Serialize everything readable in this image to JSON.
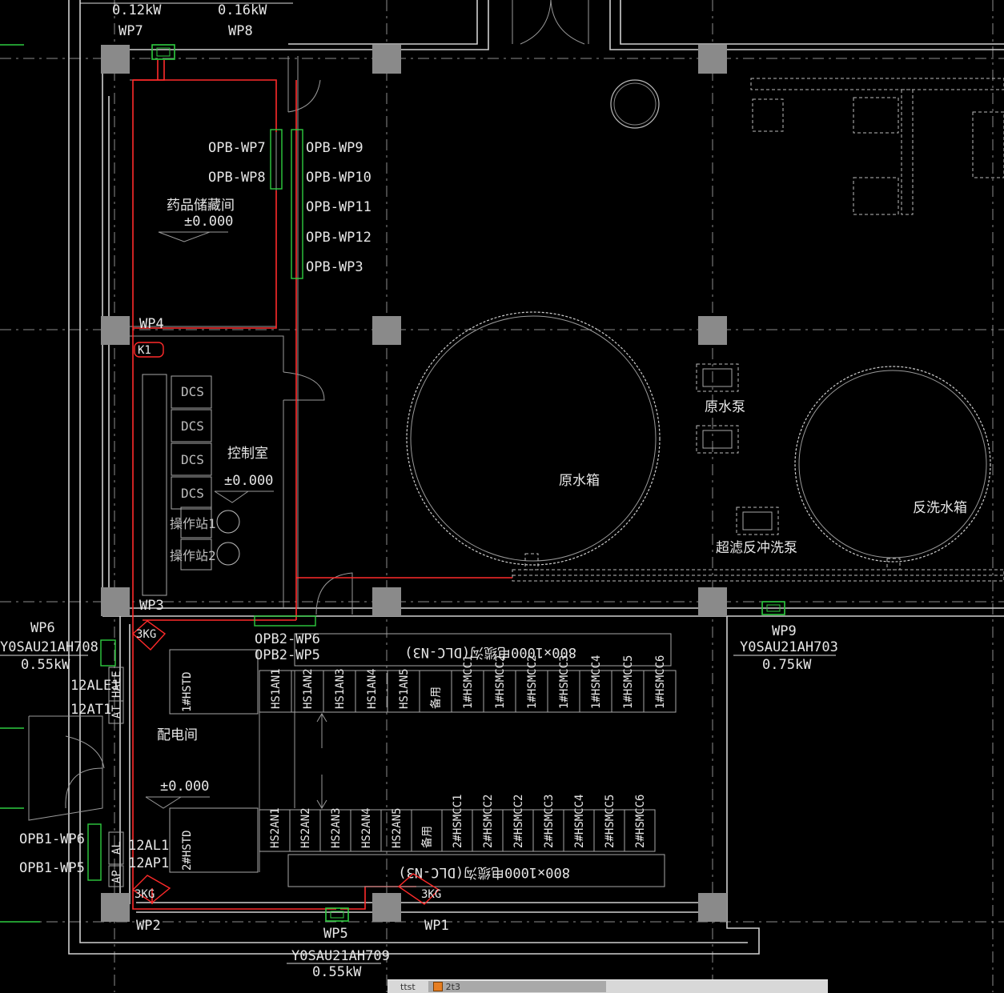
{
  "rooms": {
    "storage": {
      "name": "药品储藏间",
      "elevation": "±0.000"
    },
    "control": {
      "name": "控制室",
      "elevation": "±0.000"
    },
    "electrical": {
      "name": "配电间",
      "elevation": "±0.000"
    },
    "raw_tank": {
      "name": "原水箱"
    },
    "backwash_tank": {
      "name": "反洗水箱"
    },
    "raw_pump": {
      "name": "原水泵"
    },
    "uf_pump": {
      "name": "超滤反冲洗泵"
    }
  },
  "equipment": {
    "wp7": {
      "tag": "WP7",
      "power": "0.12kW"
    },
    "wp8": {
      "tag": "WP8",
      "power": "0.16kW"
    },
    "wp4": {
      "tag": "WP4"
    },
    "wp3": {
      "tag": "WP3"
    },
    "wp6": {
      "tag": "WP6",
      "code": "Y0SAU21AH708",
      "power": "0.55kW"
    },
    "wp9": {
      "tag": "WP9",
      "code": "Y0SAU21AH703",
      "power": "0.75kW"
    },
    "wp5": {
      "tag": "WP5",
      "code": "Y0SAU21AH709",
      "power": "0.55kW"
    },
    "wp2": {
      "tag": "WP2"
    },
    "wp1": {
      "tag": "WP1"
    }
  },
  "opb_labels": {
    "left": [
      "OPB-WP7",
      "OPB-WP8"
    ],
    "right": [
      "OPB-WP9",
      "OPB-WP10",
      "OPB-WP11",
      "OPB-WP12",
      "OPB-WP3"
    ],
    "bottom": [
      "OPB2-WP6",
      "OPB2-WP5"
    ],
    "opb1": [
      "OPB1-WP6",
      "OPB1-WP5"
    ]
  },
  "panels": {
    "hale": "HALE",
    "at": "AT",
    "al": "AL",
    "ap": "AP",
    "ale_label": "12ALE1",
    "at_label": "12AT1",
    "al_label": "12AL1",
    "ap_label": "12AP1",
    "kg": "3KG",
    "k1": "K1"
  },
  "dcs": [
    "DCS",
    "DCS",
    "DCS",
    "DCS"
  ],
  "stations": [
    "操作站1",
    "操作站2"
  ],
  "switchgear_top": [
    "HS1AN1",
    "HS1AN2",
    "HS1AN3",
    "HS1AN4",
    "HS1AN5",
    "备用",
    "1#HSMCC1",
    "1#HSMCC2",
    "1#HSMCC2",
    "1#HSMCC3",
    "1#HSMCC4",
    "1#HSMCC5",
    "1#HSMCC6"
  ],
  "switchgear_bottom": [
    "HS2AN1",
    "HS2AN2",
    "HS2AN3",
    "HS2AN4",
    "HS2AN5",
    "备用",
    "2#HSMCC1",
    "2#HSMCC2",
    "2#HSMCC2",
    "2#HSMCC3",
    "2#HSMCC4",
    "2#HSMCC5",
    "2#HSMCC6"
  ],
  "transformers": {
    "t1": "1#HSTD",
    "t2": "2#HSTD"
  },
  "busway": {
    "top": "800×1000电缆沟(DLC-N3)",
    "bottom": "800×1000电缆沟(DLC-N3)"
  },
  "taskbar": {
    "item1": "ttst",
    "item2": "2t3"
  },
  "colors": {
    "cable": "#ff2a2a",
    "device": "#2ecc40",
    "wall": "#cfcfcf",
    "background": "#000000"
  }
}
